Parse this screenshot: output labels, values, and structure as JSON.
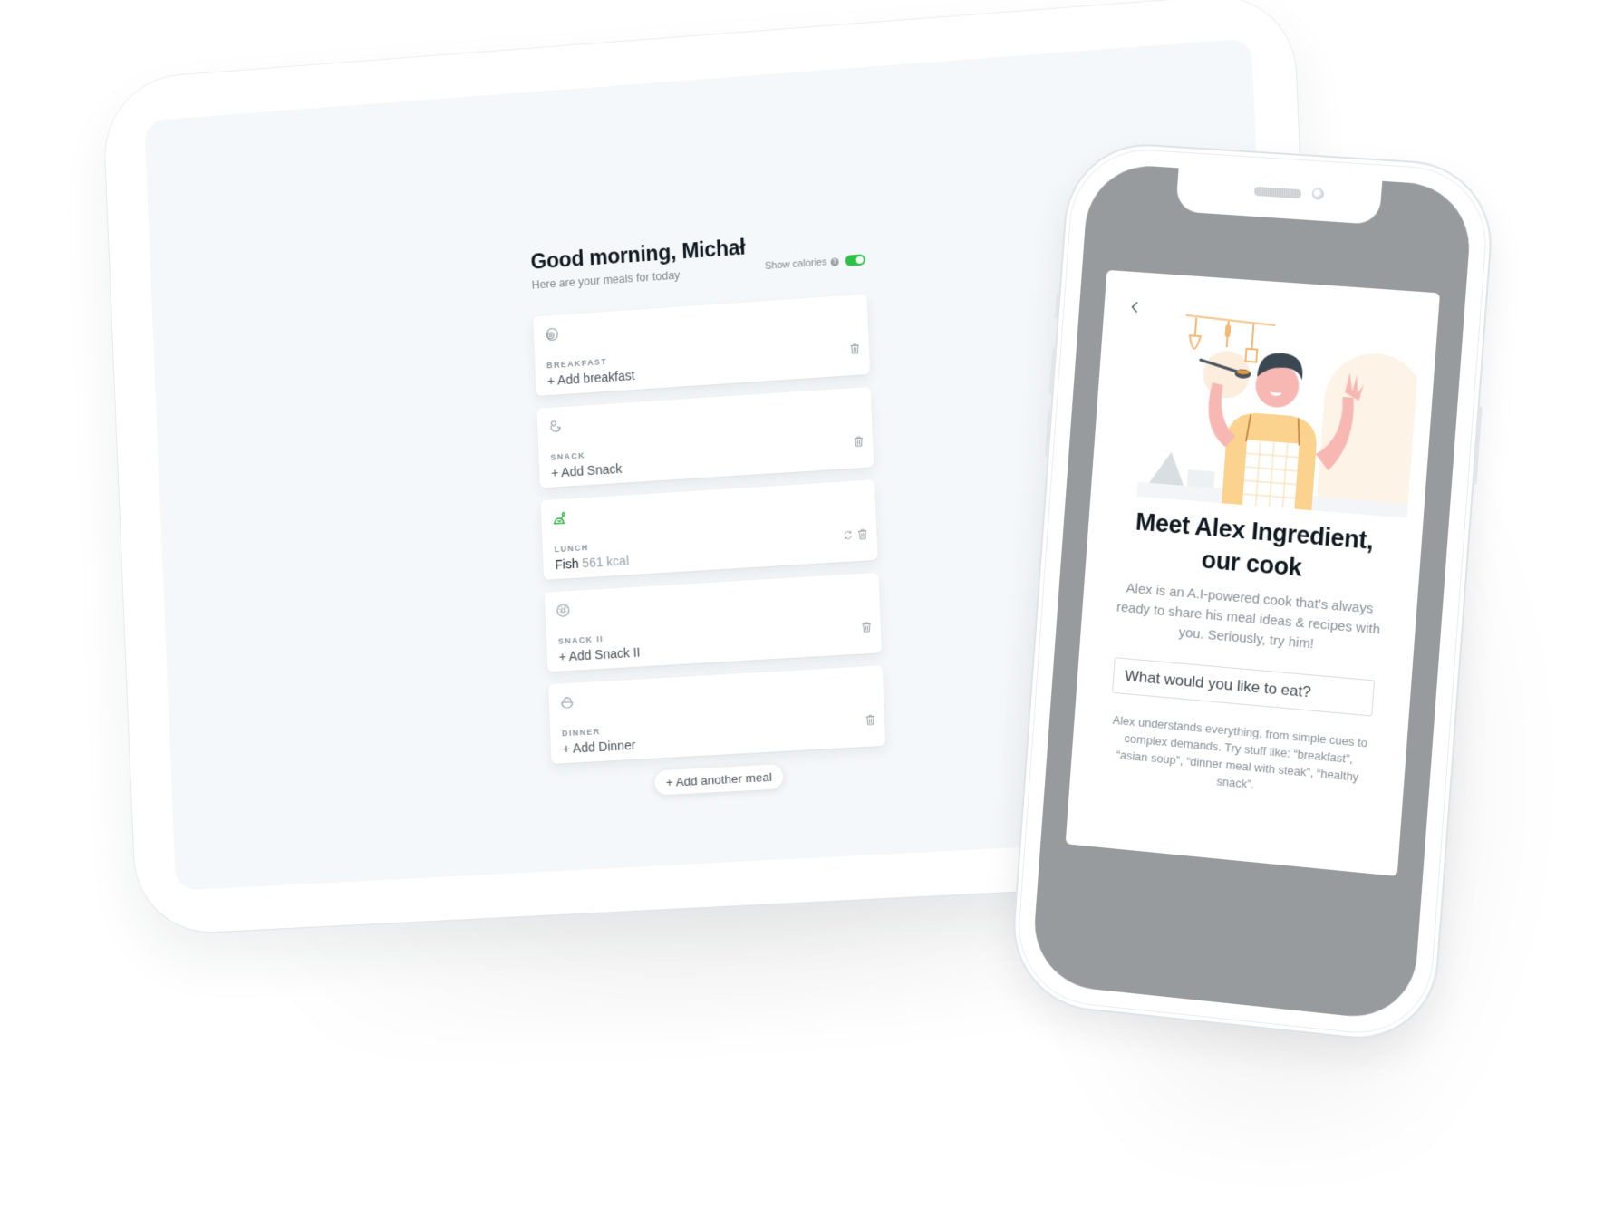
{
  "tablet": {
    "greeting": "Good morning, Michał",
    "subtitle": "Here are your meals for today",
    "show_calories_label": "Show calories",
    "help_icon": "?",
    "show_calories_enabled": true,
    "meals": [
      {
        "label": "Breakfast",
        "icon": "egg-icon",
        "value": "+ Add breakfast",
        "filled": false
      },
      {
        "label": "Snack",
        "icon": "croissant-icon",
        "value": "+ Add Snack",
        "filled": false
      },
      {
        "label": "Lunch",
        "icon": "chicken-icon",
        "dish": "Fish",
        "kcal": "561 kcal",
        "filled": true
      },
      {
        "label": "Snack II",
        "icon": "donut-icon",
        "value": "+ Add Snack II",
        "filled": false
      },
      {
        "label": "Dinner",
        "icon": "salad-bowl-icon",
        "value": "+ Add Dinner",
        "filled": false
      }
    ],
    "add_meal_label": "+ Add another meal"
  },
  "phone": {
    "title_line1": "Meet Alex Ingredient,",
    "title_line2": "our cook",
    "description": "Alex is an A.I-powered cook that’s always ready to share his meal ideas & recipes with you. Seriously, try him!",
    "input_placeholder": "What would you like to eat?",
    "hint": "Alex understands everything, from simple cues to complex demands. Try stuff like: “breakfast”, “asian soup”, “dinner meal with steak”, “healthy snack”."
  },
  "colors": {
    "accent_green": "#2fbf4a",
    "tablet_screen_bg": "#f5f8fa",
    "phone_screen_bg": "#979b9d",
    "text_dark": "#0f1820",
    "text_muted": "#8a9096"
  }
}
